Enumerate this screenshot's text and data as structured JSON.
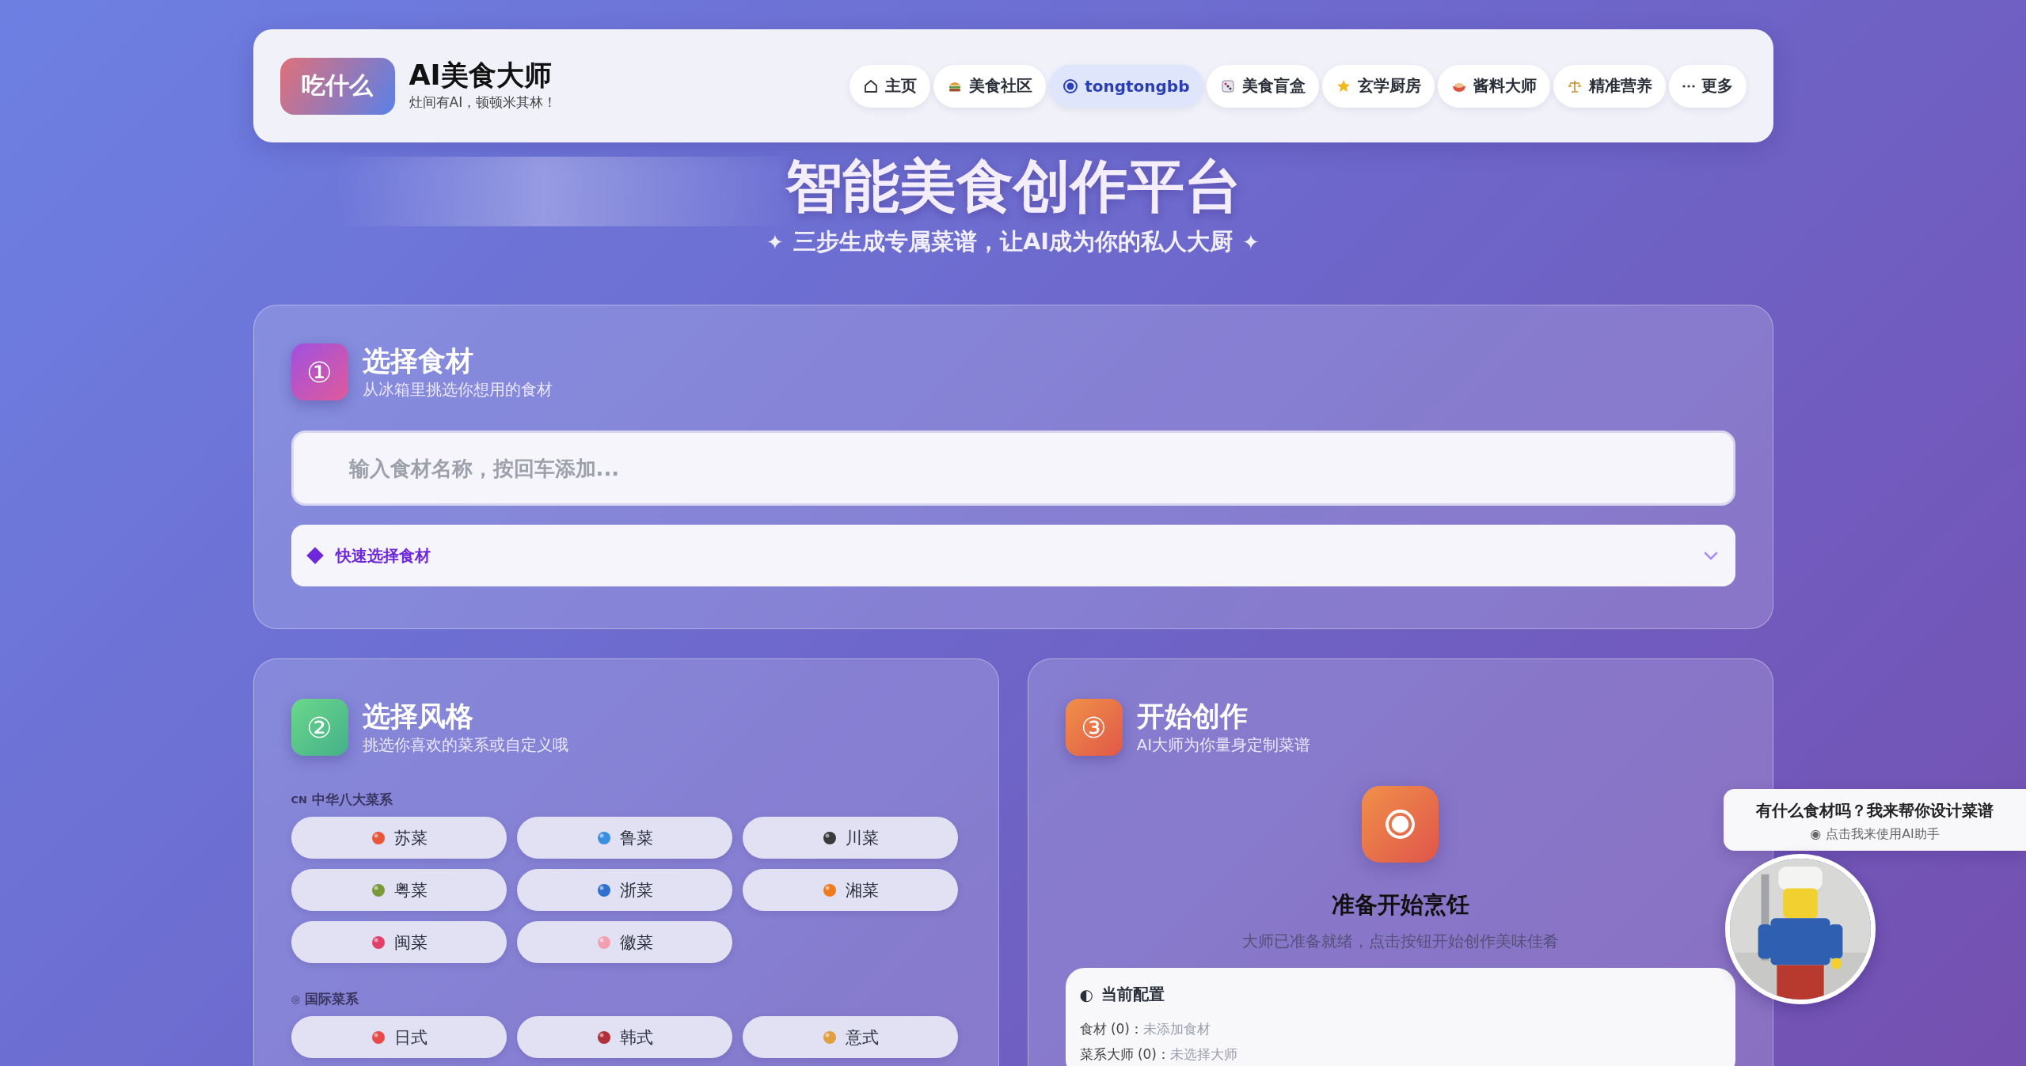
{
  "header": {
    "logo_badge": "吃什么",
    "title": "AI美食大师",
    "tagline": "灶间有AI，顿顿米其林！",
    "nav": [
      {
        "label": "主页",
        "selected": false
      },
      {
        "label": "美食社区",
        "selected": false
      },
      {
        "label": "tongtongbb",
        "selected": true
      },
      {
        "label": "美食盲盒",
        "selected": false
      },
      {
        "label": "玄学厨房",
        "selected": false
      },
      {
        "label": "酱料大师",
        "selected": false
      },
      {
        "label": "精准营养",
        "selected": false
      },
      {
        "label": "更多",
        "selected": false
      }
    ]
  },
  "hero": {
    "title": "智能美食创作平台",
    "sparkle": "✦",
    "subtitle": "三步生成专属菜谱，让AI成为你的私人大厨"
  },
  "step1": {
    "number": "①",
    "title": "选择食材",
    "subtitle": "从冰箱里挑选你想用的食材",
    "input": {
      "placeholder": "输入食材名称，按回车添加..."
    },
    "quick_select": {
      "label": "快速选择食材",
      "expanded": false
    }
  },
  "step2": {
    "number": "②",
    "title": "选择风格",
    "subtitle": "挑选你喜欢的菜系或自定义哦",
    "groups": [
      {
        "mark": "CN",
        "label": "中华八大菜系",
        "items": [
          {
            "label": "苏菜",
            "selected": false
          },
          {
            "label": "鲁菜",
            "selected": false
          },
          {
            "label": "川菜",
            "selected": false
          },
          {
            "label": "粤菜",
            "selected": false
          },
          {
            "label": "浙菜",
            "selected": false
          },
          {
            "label": "湘菜",
            "selected": false
          },
          {
            "label": "闽菜",
            "selected": false
          },
          {
            "label": "徽菜",
            "selected": false
          }
        ]
      },
      {
        "mark": "◎",
        "label": "国际菜系",
        "items": [
          {
            "label": "日式",
            "selected": false
          },
          {
            "label": "韩式",
            "selected": false
          },
          {
            "label": "意式",
            "selected": false
          }
        ]
      }
    ]
  },
  "step3": {
    "number": "③",
    "title": "开始创作",
    "subtitle": "AI大师为你量身定制菜谱",
    "status_title": "准备开始烹饪",
    "status_text": "大师已准备就绪，点击按钮开始创作美味佳肴",
    "config": {
      "mark": "◐",
      "title": "当前配置",
      "rows": [
        {
          "label": "食材 (0)：",
          "value": "未添加食材"
        },
        {
          "label": "菜系大师 (0)：",
          "value": "未选择大师"
        }
      ]
    }
  },
  "assistant": {
    "message": "有什么食材吗？我来帮你设计菜谱",
    "mark": "◉",
    "hint": "点击我来使用AI助手"
  }
}
